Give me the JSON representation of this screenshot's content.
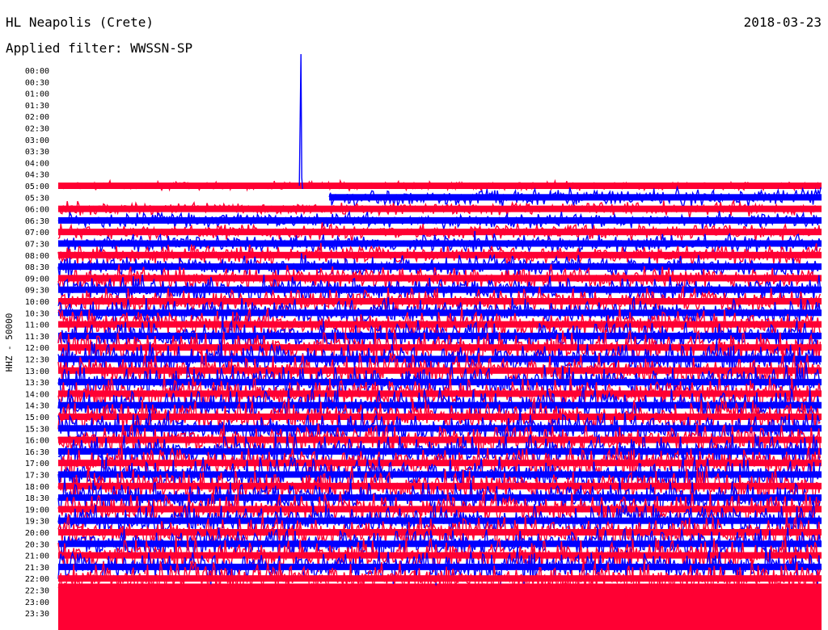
{
  "header": {
    "station": "HL Neapolis (Crete)",
    "date": "2018-03-23",
    "filter": "Applied filter: WWSSN-SP"
  },
  "channel_label": "HHZ - 50000",
  "colors": {
    "trace_a": "#ff0033",
    "trace_b": "#0000ff",
    "background": "#ffffff",
    "text": "#000000"
  },
  "chart_data": {
    "type": "line",
    "description_free": true,
    "y_axis_ticks": [
      "00:00",
      "00:30",
      "01:00",
      "01:30",
      "02:00",
      "02:30",
      "03:00",
      "03:30",
      "04:00",
      "04:30",
      "05:00",
      "05:30",
      "06:00",
      "06:30",
      "07:00",
      "07:30",
      "08:00",
      "08:30",
      "09:00",
      "09:30",
      "10:00",
      "10:30",
      "11:00",
      "11:30",
      "12:00",
      "12:30",
      "13:00",
      "13:30",
      "14:00",
      "14:30",
      "15:00",
      "15:30",
      "16:00",
      "16:30",
      "17:00",
      "17:30",
      "18:00",
      "18:30",
      "19:00",
      "19:30",
      "20:00",
      "20:30",
      "21:00",
      "21:30",
      "22:00",
      "22:30",
      "23:00",
      "23:30"
    ],
    "first_trace_row": "05:00",
    "last_trace_row": "22:00",
    "trace_colors_alternate": [
      "#ff0033",
      "#0000ff"
    ],
    "first_row_data_start_fraction": 0.0,
    "second_row_data_start_fraction": 0.355,
    "spike_x_fraction": 0.318,
    "spike_row": "04:30",
    "spike_peak_row": "00:00",
    "grid": false,
    "legend": "none"
  }
}
